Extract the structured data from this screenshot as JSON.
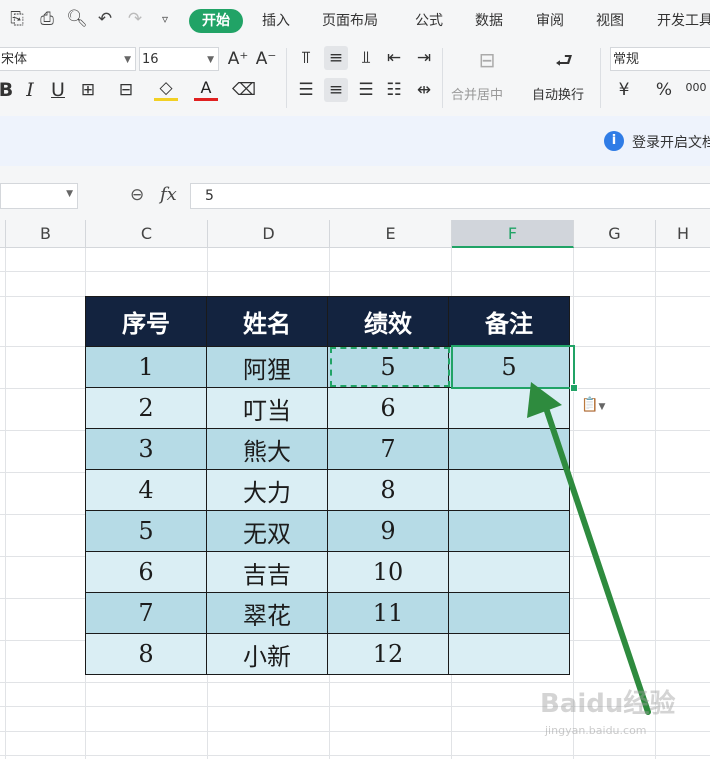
{
  "tabs": {
    "home": "开始",
    "insert": "插入",
    "layout": "页面布局",
    "formulas": "公式",
    "data": "数据",
    "review": "审阅",
    "view": "视图",
    "developer": "开发工具"
  },
  "ribbon": {
    "font_name": "宋体",
    "font_size": "16",
    "merge_center": "合并居中",
    "wrap_text": "自动换行",
    "number_format": "常规",
    "currency_symbol": "¥",
    "percent_symbol": "%",
    "thousands_symbol": "000"
  },
  "notice": {
    "text": "登录开启文档"
  },
  "formula_bar": {
    "fx_label": "fx",
    "value": "5"
  },
  "columns": [
    "B",
    "C",
    "D",
    "E",
    "F",
    "G",
    "H"
  ],
  "selected_column": "F",
  "table": {
    "headers": [
      "序号",
      "姓名",
      "绩效",
      "备注"
    ],
    "rows": [
      [
        "1",
        "阿狸",
        "5",
        "5"
      ],
      [
        "2",
        "叮当",
        "6",
        ""
      ],
      [
        "3",
        "熊大",
        "7",
        ""
      ],
      [
        "4",
        "大力",
        "8",
        ""
      ],
      [
        "5",
        "无双",
        "9",
        ""
      ],
      [
        "6",
        "吉吉",
        "10",
        ""
      ],
      [
        "7",
        "翠花",
        "11",
        ""
      ],
      [
        "8",
        "小新",
        "12",
        ""
      ]
    ]
  },
  "colors": {
    "accent": "#21a366",
    "header_bg": "#13233f",
    "row_dark": "#b6dbe6",
    "row_light": "#daeef4",
    "arrow": "#2e8b3e"
  },
  "watermark": {
    "brand": "Baidu经验",
    "sub": "jingyan.baidu.com"
  }
}
